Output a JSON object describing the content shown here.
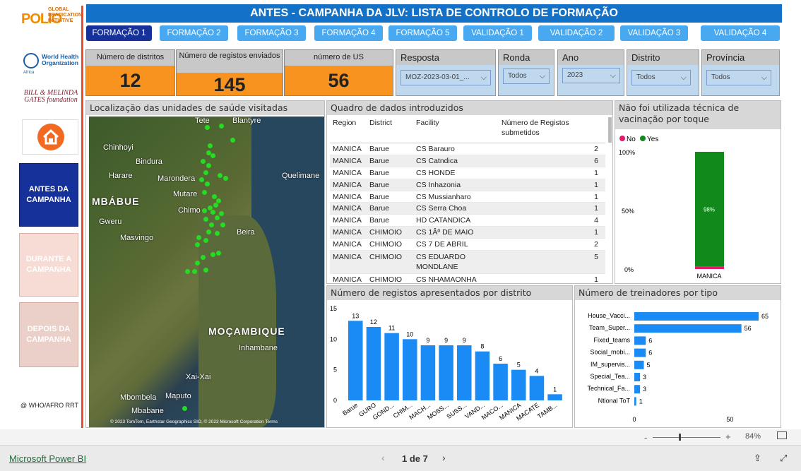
{
  "title": "ANTES - CAMPANHA DA JLV: LISTA DE CONTROLO DE FORMAÇÃO",
  "sidebar": {
    "polio_big": "POLIO",
    "polio_small": "GLOBAL ERADICATION INITIATIVE",
    "who_name": "World Health Organization",
    "who_sub": "Africa",
    "gates": "BILL & MELINDA GATES foundation",
    "nav_antes": "ANTES DA CAMPANHA",
    "nav_durante": "DURANTE A CAMPANHA",
    "nav_depois": "DEPOIS DA CAMPANHA",
    "footer": "@ WHO/AFRO RRT"
  },
  "tabs": [
    "FORMAÇÃO 1",
    "FORMAÇÃO 2",
    "FORMAÇÃO 3",
    "FORMAÇÃO 4",
    "FORMAÇÃO 5",
    "VALIDAÇÃO 1",
    "VALIDAÇÃO 2",
    "VALIDAÇÃO 3",
    "VALIDAÇÃO 4"
  ],
  "kpis": {
    "districts_label": "Número de distritos",
    "districts_value": "12",
    "records_label": "Número de registos enviados",
    "records_value": "145",
    "us_label": "número de US",
    "us_value": "56"
  },
  "slicers": {
    "resposta_label": "Resposta",
    "resposta_value": "MOZ-2023-03-01_...",
    "ronda_label": "Ronda",
    "ronda_value": "Todos",
    "ano_label": "Ano",
    "ano_value": "2023",
    "distrito_label": "Distrito",
    "distrito_value": "Todos",
    "provincia_label": "Província",
    "provincia_value": "Todos"
  },
  "map": {
    "title": "Localização das unidades de saúde visitadas",
    "labels": [
      "Tete",
      "Blantyre",
      "Chinhoyi",
      "Bindura",
      "Harare",
      "Marondera",
      "Quelimane",
      "MBÁBUE",
      "Mutare",
      "Chimo",
      "Gweru",
      "Masvingo",
      "Beira",
      "MOÇAMBIQUE",
      "Inhambane",
      "Xai-Xai",
      "Mbombela",
      "Maputo",
      "Mbabane"
    ],
    "attribution": "© 2023 TomTom, Earthstar Geographics SIO, © 2023 Microsoft Corporation  Terms"
  },
  "table": {
    "title": "Quadro de dados introduzidos",
    "headers": [
      "Region",
      "District",
      "Facility",
      "Número de Registos submetidos"
    ],
    "rows": [
      [
        "MANICA",
        "Barue",
        "CS Barauro",
        "2"
      ],
      [
        "MANICA",
        "Barue",
        "CS Catndica",
        "6"
      ],
      [
        "MANICA",
        "Barue",
        "CS HONDE",
        "1"
      ],
      [
        "MANICA",
        "Barue",
        "CS Inhazonia",
        "1"
      ],
      [
        "MANICA",
        "Barue",
        "CS Mussianharo",
        "1"
      ],
      [
        "MANICA",
        "Barue",
        "CS Serra Choa",
        "1"
      ],
      [
        "MANICA",
        "Barue",
        "HD CATANDICA",
        "4"
      ],
      [
        "MANICA",
        "CHIMOIO",
        "CS 1Âº DE MAIO",
        "1"
      ],
      [
        "MANICA",
        "CHIMOIO",
        "CS 7 DE ABRIL",
        "2"
      ],
      [
        "MANICA",
        "CHIMOIO",
        "CS EDUARDO MONDLANE",
        "5"
      ],
      [
        "MANICA",
        "CHIMOIO",
        "CS NHAMAONHA",
        "1"
      ]
    ]
  },
  "stack": {
    "title": "Não foi utilizada técnica de vacinação por toque",
    "legend_no": "No",
    "legend_yes": "Yes",
    "color_no": "#e5186b",
    "color_yes": "#12891b",
    "yticks": [
      "100%",
      "50%",
      "0%"
    ],
    "category": "MANICA",
    "yes_pct": 98,
    "yes_label": "98%"
  },
  "chart_data": [
    {
      "type": "bar",
      "title": "Número de registos apresentados por distrito",
      "categories": [
        "Barue",
        "GURO",
        "GOND...",
        "CHIM...",
        "MACH...",
        "MOSS...",
        "SUSS...",
        "VAND...",
        "MACO...",
        "MANICA",
        "MACATE",
        "TAMB..."
      ],
      "values": [
        13,
        12,
        11,
        10,
        9,
        9,
        9,
        8,
        6,
        5,
        4,
        1
      ],
      "yticks": [
        0,
        5,
        10,
        15
      ],
      "ylim": [
        0,
        15
      ],
      "color": "#1a8af5"
    },
    {
      "type": "bar",
      "orientation": "horizontal",
      "title": "Número de treinadores por tipo",
      "categories": [
        "House_Vacci...",
        "Team_Super...",
        "Fixed_teams",
        "Social_mobi...",
        "IM_supervis...",
        "Special_Tea...",
        "Technical_Fa...",
        "Ntional ToT"
      ],
      "values": [
        65,
        56,
        6,
        6,
        5,
        3,
        3,
        1
      ],
      "xticks": [
        0,
        50
      ],
      "xlim": [
        0,
        72
      ],
      "color": "#1a8af5"
    }
  ],
  "zoom": {
    "minus": "-",
    "plus": "+",
    "level": "84%"
  },
  "bottom": {
    "brand": "Microsoft Power BI",
    "page": "1 de 7"
  }
}
